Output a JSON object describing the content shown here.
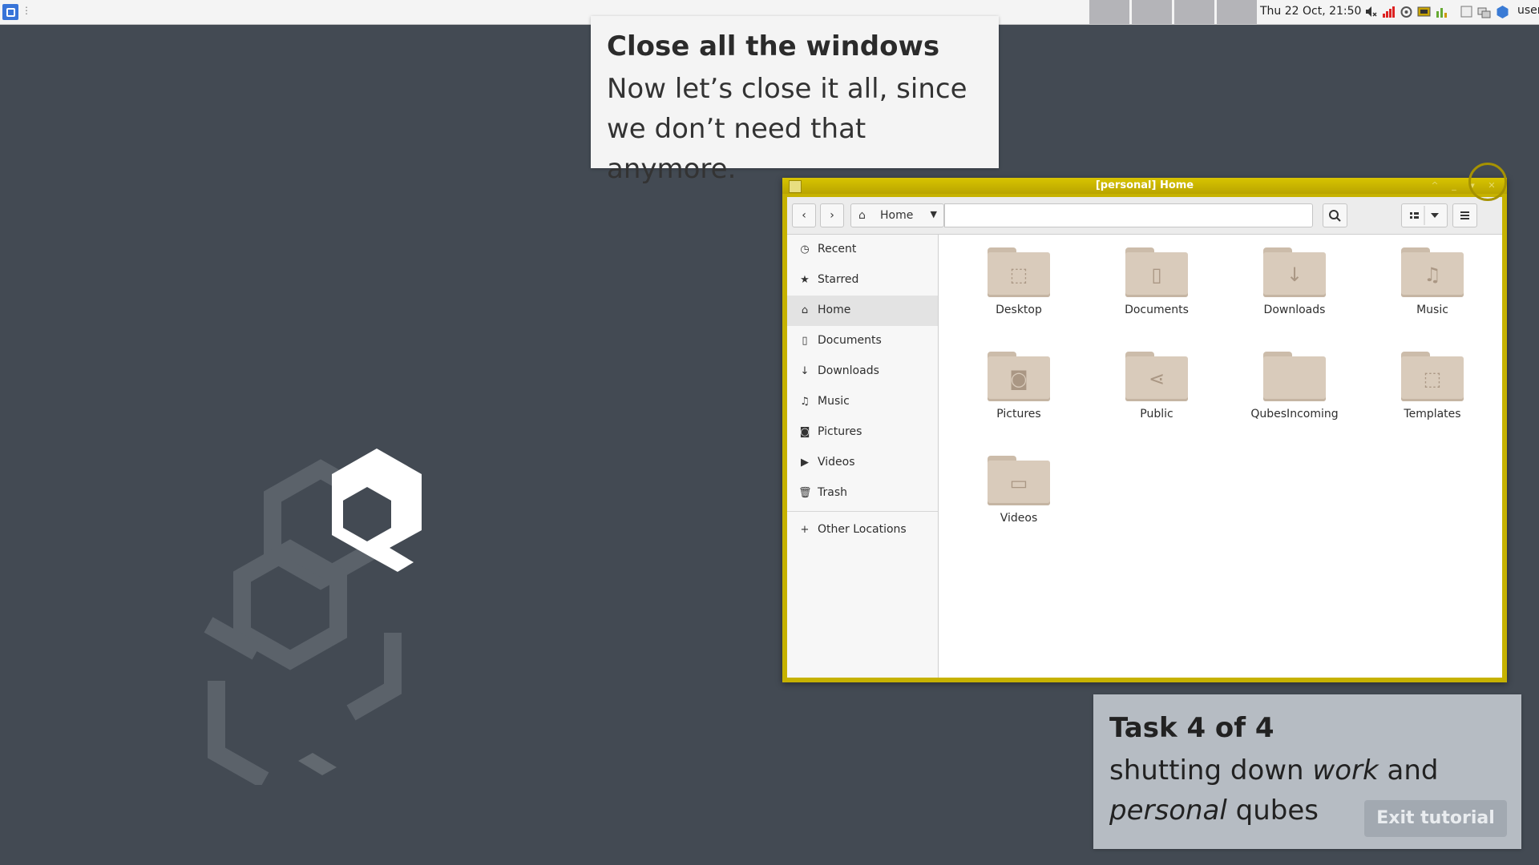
{
  "panel": {
    "clock": "Thu 22 Oct, 21:50",
    "user": "user",
    "tray_icons": [
      "volume-muted-icon",
      "network-signal-icon",
      "updates-icon",
      "devices-icon",
      "disk-icon",
      "window-icon",
      "qube-icon",
      "qube-icon"
    ]
  },
  "tutorial": {
    "title": "Close all the windows",
    "body": "Now let’s close it all, since we don’t need that anymore.",
    "task_heading": "Task 4 of 4",
    "task_line1": "shutting down",
    "task_em1": "work",
    "task_and": "and",
    "task_em2": "personal",
    "task_end": "qubes",
    "exit_label": "Exit tutorial"
  },
  "window": {
    "title": "[personal] Home",
    "border_color": "#c6b200",
    "path_label": "Home"
  },
  "sidebar": {
    "items": [
      {
        "label": "Recent",
        "icon": "clock-icon"
      },
      {
        "label": "Starred",
        "icon": "star-icon"
      },
      {
        "label": "Home",
        "icon": "home-icon",
        "active": true
      },
      {
        "label": "Documents",
        "icon": "document-icon"
      },
      {
        "label": "Downloads",
        "icon": "download-icon"
      },
      {
        "label": "Music",
        "icon": "music-icon"
      },
      {
        "label": "Pictures",
        "icon": "camera-icon"
      },
      {
        "label": "Videos",
        "icon": "video-icon"
      },
      {
        "label": "Trash",
        "icon": "trash-icon"
      }
    ],
    "other_locations": "Other Locations"
  },
  "files": [
    {
      "label": "Desktop"
    },
    {
      "label": "Documents"
    },
    {
      "label": "Downloads"
    },
    {
      "label": "Music"
    },
    {
      "label": "Pictures"
    },
    {
      "label": "Public"
    },
    {
      "label": "QubesIncoming"
    },
    {
      "label": "Templates"
    },
    {
      "label": "Videos"
    }
  ]
}
